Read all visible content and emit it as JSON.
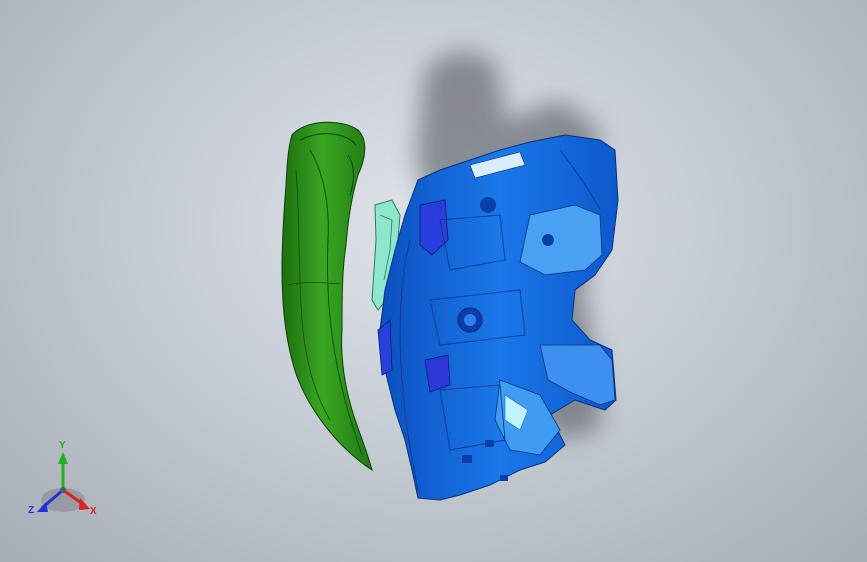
{
  "viewport": {
    "background": "#c3c9d1",
    "scene": {
      "parts": [
        {
          "name": "green-panel",
          "color": "#2f9a1c"
        },
        {
          "name": "teal-bracket",
          "color": "#7fe0c8"
        },
        {
          "name": "blue-assembly",
          "color": "#1a6fe0"
        }
      ]
    }
  },
  "triad": {
    "x_label": "X",
    "y_label": "Y",
    "z_label": "Z",
    "x_color": "#e02020",
    "y_color": "#20b020",
    "z_color": "#2030e0"
  }
}
